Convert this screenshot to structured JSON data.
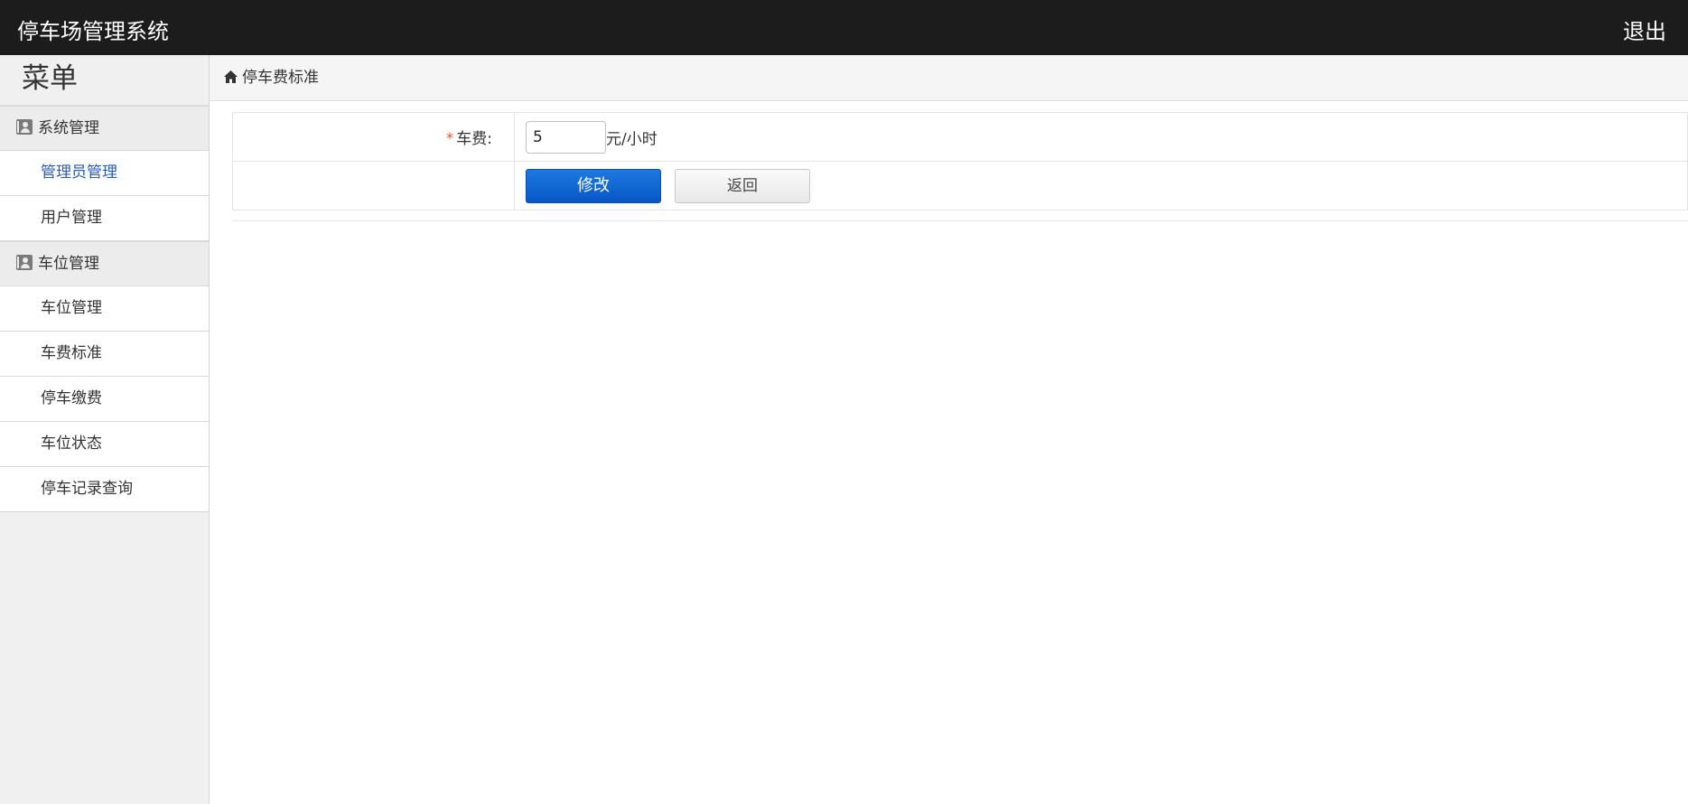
{
  "header": {
    "app_title": "停车场管理系统",
    "logout_label": "退出"
  },
  "sidebar": {
    "menu_title": "菜单",
    "groups": [
      {
        "label": "系统管理",
        "icon": "contact-card-icon",
        "items": [
          {
            "label": "管理员管理",
            "active": true
          },
          {
            "label": "用户管理",
            "active": false
          }
        ]
      },
      {
        "label": "车位管理",
        "icon": "contact-card-icon",
        "items": [
          {
            "label": "车位管理",
            "active": false
          },
          {
            "label": "车费标准",
            "active": false
          },
          {
            "label": "停车缴费",
            "active": false
          },
          {
            "label": "车位状态",
            "active": false
          },
          {
            "label": "停车记录查询",
            "active": false
          }
        ]
      }
    ]
  },
  "breadcrumb": {
    "icon": "home-icon",
    "label": "停车费标准"
  },
  "form": {
    "required_mark": "*",
    "fee_label": "车费:",
    "fee_value": "5",
    "fee_unit": "元/小时",
    "submit_label": "修改",
    "back_label": "返回"
  },
  "colors": {
    "topbar": "#1c1c1c",
    "active_link": "#2a5db0",
    "primary_button": "#0657c6",
    "required_mark": "#e8632a"
  }
}
